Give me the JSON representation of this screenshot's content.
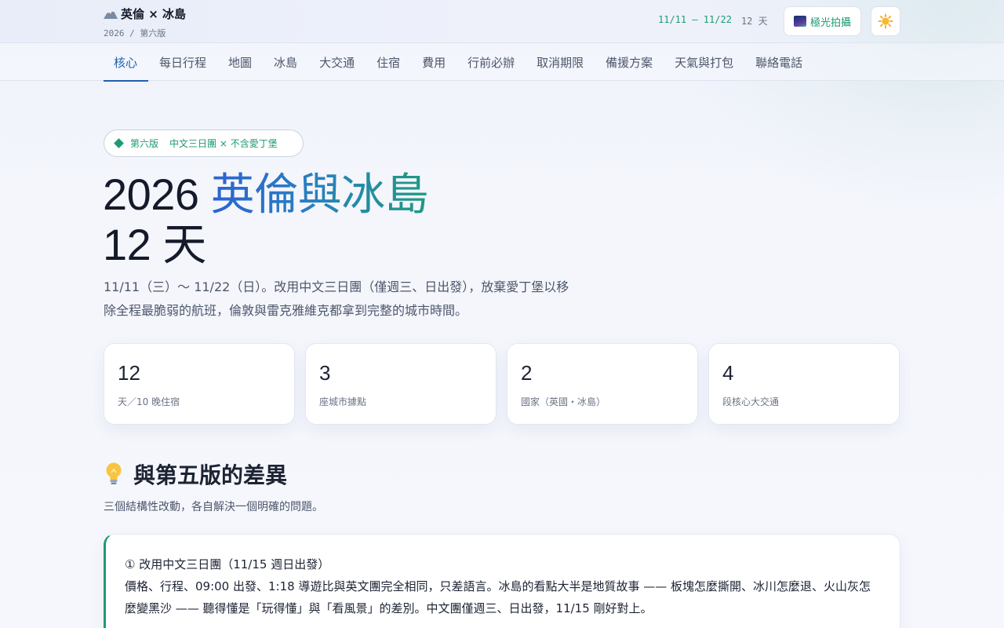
{
  "header": {
    "brand_title": "英倫 × 冰島",
    "brand_sub": "2026 / 第六版",
    "date_range": "11/11 – 11/22",
    "days": "12 天",
    "aurora_label": "極光拍攝",
    "icons": {
      "brand": "mountain-icon",
      "aurora": "aurora-icon",
      "theme": "sun-icon"
    }
  },
  "nav": {
    "tabs": [
      {
        "label": "核心",
        "active": true
      },
      {
        "label": "每日行程"
      },
      {
        "label": "地圖"
      },
      {
        "label": "冰島"
      },
      {
        "label": "大交通"
      },
      {
        "label": "住宿"
      },
      {
        "label": "費用"
      },
      {
        "label": "行前必辦"
      },
      {
        "label": "取消期限"
      },
      {
        "label": "備援方案"
      },
      {
        "label": "天氣與打包"
      },
      {
        "label": "聯絡電話"
      }
    ]
  },
  "hero": {
    "pill_version": "第六版",
    "pill_desc": "中文三日團 × 不含愛丁堡",
    "title_prefix": "2026 ",
    "title_highlight": "英倫與冰島",
    "title_line2": "12 天",
    "desc": "11/11（三）～ 11/22（日）。改用中文三日團（僅週三、日出發），放棄愛丁堡以移除全程最脆弱的航班，倫敦與雷克雅維克都拿到完整的城市時間。"
  },
  "stats": [
    {
      "num": "12",
      "label": "天／10 晚住宿"
    },
    {
      "num": "3",
      "label": "座城市據點"
    },
    {
      "num": "2",
      "label": "國家（英國・冰島）"
    },
    {
      "num": "4",
      "label": "段核心大交通"
    }
  ],
  "section": {
    "title": "與第五版的差異",
    "subtitle": "三個結構性改動，各自解決一個明確的問題。",
    "cards": [
      {
        "title": "① 改用中文三日團（11/15 週日出發）",
        "body": "價格、行程、09:00 出發、1:18 導遊比與英文團完全相同，只差語言。冰島的看點大半是地質故事 —— 板塊怎麼撕開、冰川怎麼退、火山灰怎麼變黑沙 —— 聽得懂是「玩得懂」與「看風景」的差別。中文團僅週三、日出發，11/15 剛好對上。"
      }
    ]
  },
  "colors": {
    "accent_blue": "#1f5fae",
    "accent_green": "#1e9a72"
  }
}
